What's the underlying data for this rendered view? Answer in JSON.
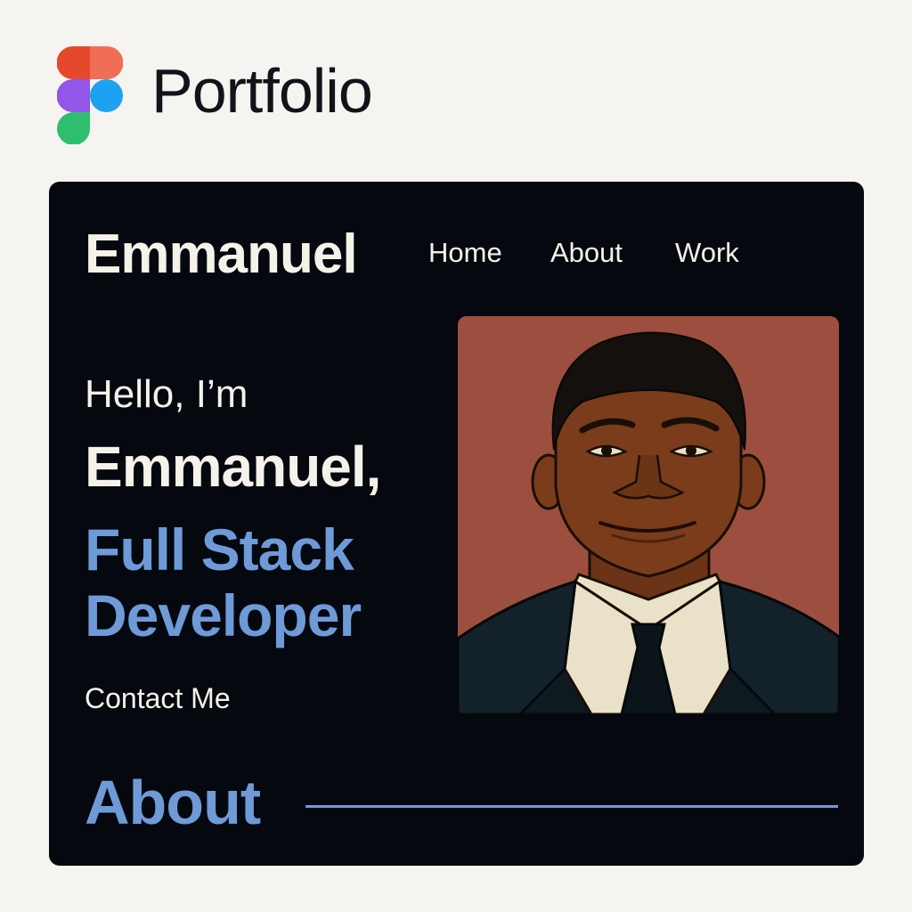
{
  "app": {
    "title": "Portfolio",
    "logo_icon": "figma-logo-icon"
  },
  "site": {
    "brand": "Emmanuel",
    "nav": [
      {
        "label": "Home"
      },
      {
        "label": "About"
      },
      {
        "label": "Work"
      }
    ],
    "hero": {
      "greeting": "Hello, I’m",
      "name": "Emmanuel,",
      "role_line1": "Full Stack",
      "role_line2": "Developer",
      "cta": "Contact Me"
    },
    "portrait_icon": "avatar-portrait",
    "section": {
      "title": "About"
    }
  },
  "colors": {
    "page_background": "#f6f4f0",
    "site_background": "#05090f",
    "text_light": "#f5f2ea",
    "accent_blue": "#6f9ad8",
    "portrait_background": "#9c4f3e"
  }
}
